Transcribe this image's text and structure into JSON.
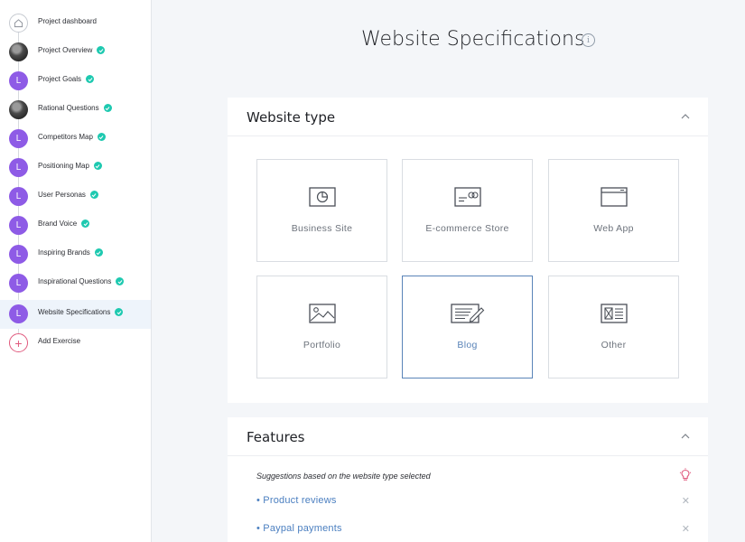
{
  "sidebar": {
    "items": [
      {
        "label": "Project dashboard",
        "avatar": "home-icon",
        "done": false
      },
      {
        "label": "Project Overview",
        "avatar": "photo",
        "done": true
      },
      {
        "label": "Project Goals",
        "avatar": "L",
        "done": true
      },
      {
        "label": "Rational Questions",
        "avatar": "photo",
        "done": true
      },
      {
        "label": "Competitors Map",
        "avatar": "L",
        "done": true
      },
      {
        "label": "Positioning Map",
        "avatar": "L",
        "done": true
      },
      {
        "label": "User Personas",
        "avatar": "L",
        "done": true
      },
      {
        "label": "Brand Voice",
        "avatar": "L",
        "done": true
      },
      {
        "label": "Inspiring Brands",
        "avatar": "L",
        "done": true
      },
      {
        "label": "Inspirational Questions",
        "avatar": "L",
        "done": true
      },
      {
        "label": "Website Specifications",
        "avatar": "L",
        "done": true,
        "active": true
      },
      {
        "label": "Add Exercise",
        "avatar": "plus-icon",
        "done": false
      }
    ]
  },
  "page": {
    "title": "Website Specifications",
    "info_icon": "info-icon"
  },
  "website_type": {
    "title": "Website type",
    "options": [
      {
        "label": "Business Site",
        "icon": "chart-icon",
        "selected": false
      },
      {
        "label": "E-commerce Store",
        "icon": "card-icon",
        "selected": false
      },
      {
        "label": "Web App",
        "icon": "browser-icon",
        "selected": false
      },
      {
        "label": "Portfolio",
        "icon": "image-icon",
        "selected": false
      },
      {
        "label": "Blog",
        "icon": "blog-icon",
        "selected": true
      },
      {
        "label": "Other",
        "icon": "layout-icon",
        "selected": false
      }
    ]
  },
  "features": {
    "title": "Features",
    "suggestion": "Suggestions based on the website type selected",
    "items": [
      {
        "label": "• Product reviews"
      },
      {
        "label": "• Paypal payments"
      }
    ]
  },
  "colors": {
    "accent": "#5a84b8",
    "letter_avatar": "#8e5be6",
    "check": "#1ec9b0",
    "add": "#e05a7e"
  }
}
